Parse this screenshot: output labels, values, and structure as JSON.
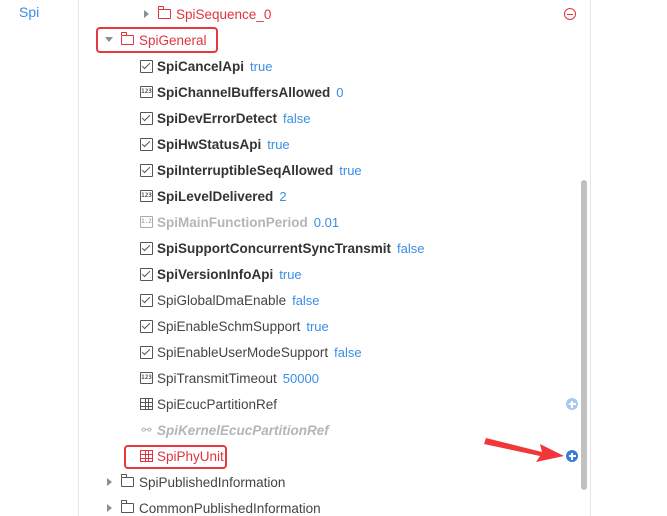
{
  "left_panel": {
    "tab_label": "Spi"
  },
  "tree": {
    "seq_node": {
      "label": "SpiSequence_0"
    },
    "general_node": {
      "label": "SpiGeneral"
    },
    "params": [
      {
        "name": "SpiCancelApi",
        "value": "true",
        "icon": "checkbox-icon",
        "style": "bold"
      },
      {
        "name": "SpiChannelBuffersAllowed",
        "value": "0",
        "icon": "number-icon",
        "style": "bold"
      },
      {
        "name": "SpiDevErrorDetect",
        "value": "false",
        "icon": "checkbox-icon",
        "style": "bold"
      },
      {
        "name": "SpiHwStatusApi",
        "value": "true",
        "icon": "checkbox-icon",
        "style": "bold"
      },
      {
        "name": "SpiInterruptibleSeqAllowed",
        "value": "true",
        "icon": "checkbox-icon",
        "style": "bold"
      },
      {
        "name": "SpiLevelDelivered",
        "value": "2",
        "icon": "number-icon",
        "style": "bold"
      },
      {
        "name": "SpiMainFunctionPeriod",
        "value": "0.01",
        "icon": "float-icon",
        "style": "grey"
      },
      {
        "name": "SpiSupportConcurrentSyncTransmit",
        "value": "false",
        "icon": "checkbox-icon",
        "style": "bold"
      },
      {
        "name": "SpiVersionInfoApi",
        "value": "true",
        "icon": "checkbox-icon",
        "style": "bold"
      },
      {
        "name": "SpiGlobalDmaEnable",
        "value": "false",
        "icon": "checkbox-icon",
        "style": "normal"
      },
      {
        "name": "SpiEnableSchmSupport",
        "value": "true",
        "icon": "checkbox-icon",
        "style": "normal"
      },
      {
        "name": "SpiEnableUserModeSupport",
        "value": "false",
        "icon": "checkbox-icon",
        "style": "normal"
      },
      {
        "name": "SpiTransmitTimeout",
        "value": "50000",
        "icon": "number-icon",
        "style": "normal"
      }
    ],
    "partition_ref": {
      "label": "SpiEcucPartitionRef"
    },
    "kernel_ref": {
      "label": "SpiKernelEcucPartitionRef"
    },
    "phy_unit": {
      "label": "SpiPhyUnit"
    },
    "published_info": {
      "label": "SpiPublishedInformation"
    },
    "common_published_info": {
      "label": "CommonPublishedInformation"
    }
  },
  "colors": {
    "accent": "#3a8ee6",
    "highlight": "#e8383d",
    "red_text": "#e0343f"
  }
}
